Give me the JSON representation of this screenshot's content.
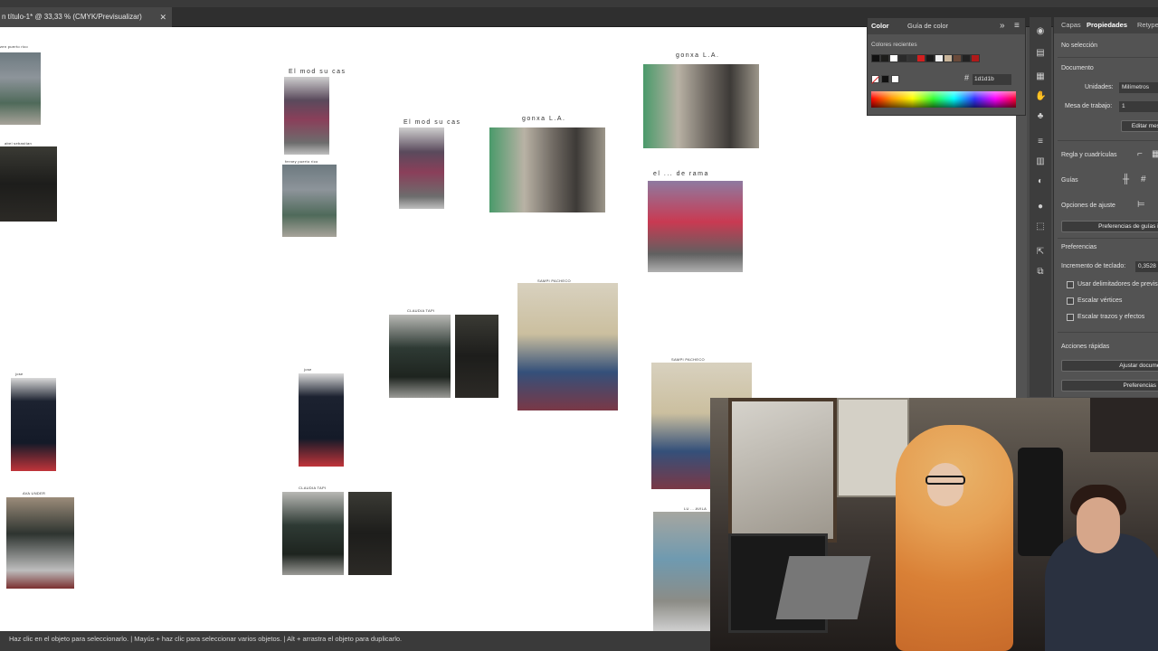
{
  "document": {
    "tab_title": "n título-1* @ 33,33 % (CMYK/Previsualizar)",
    "close_glyph": "✕"
  },
  "artboard": {
    "captions": {
      "c1": "zen  puerto rico",
      "c2": "abel sebastian",
      "c3": "El mod su cas",
      "c4": "ferney  puerto rico",
      "c5": "El mod su cas",
      "c6": "gonxa L.A.",
      "c7": "gonxa L.A.",
      "c8": "el ... de rama",
      "c9": "CLAUDIA TAPI",
      "c10": "SAMPI PACHECO",
      "c11": "SAMPI PACHECO",
      "c12": "jose",
      "c13": "jose",
      "c14": "AVA UNDER",
      "c15": "CLAUDIA TAPI",
      "c16": "LU ... AVILA"
    }
  },
  "color_panel": {
    "tab_color": "Color",
    "tab_guide": "Guía de color",
    "recent_label": "Colores recientes",
    "hex_value": "1d1d1b",
    "expand_icon": "»",
    "menu_icon": "≡",
    "swatches": [
      "#111111",
      "#1d1d1b",
      "#ffffff",
      "#2a2a2a",
      "#333333",
      "#d21f1f",
      "#1a1a1a",
      "#f2f2f2",
      "#c8b49a",
      "#6a4a3a",
      "#222222",
      "#b01a1a"
    ]
  },
  "properties_panel": {
    "tab_layers": "Capas",
    "tab_properties": "Propiedades",
    "tab_retype": "Retype",
    "no_selection": "No selección",
    "document_label": "Documento",
    "units_label": "Unidades:",
    "units_value": "Milímetros",
    "artboard_label": "Mesa de trabajo:",
    "artboard_value": "1",
    "edit_button": "Editar mes",
    "rulers_label": "Regla y cuadrículas",
    "guides_label": "Guías",
    "snap_label": "Opciones de ajuste",
    "snap_button": "Preferencias de guías int",
    "preferences_label": "Preferencias",
    "keyboard_increment_label": "Incremento de teclado:",
    "keyboard_increment_value": "0,3528",
    "check_preview": "Usar delimitadores de previs",
    "check_scale_corners": "Escalar vértices",
    "check_scale_strokes": "Escalar trazos y efectos",
    "quick_actions_label": "Acciones rápidas",
    "fit_document_button": "Ajustar documen",
    "preferences_button": "Preferencias"
  },
  "status_bar": {
    "text": "Haz clic en el objeto para seleccionarlo.  |  Mayús + haz clic para seleccionar varios objetos.  |  Alt + arrastra el objeto para duplicarlo."
  }
}
